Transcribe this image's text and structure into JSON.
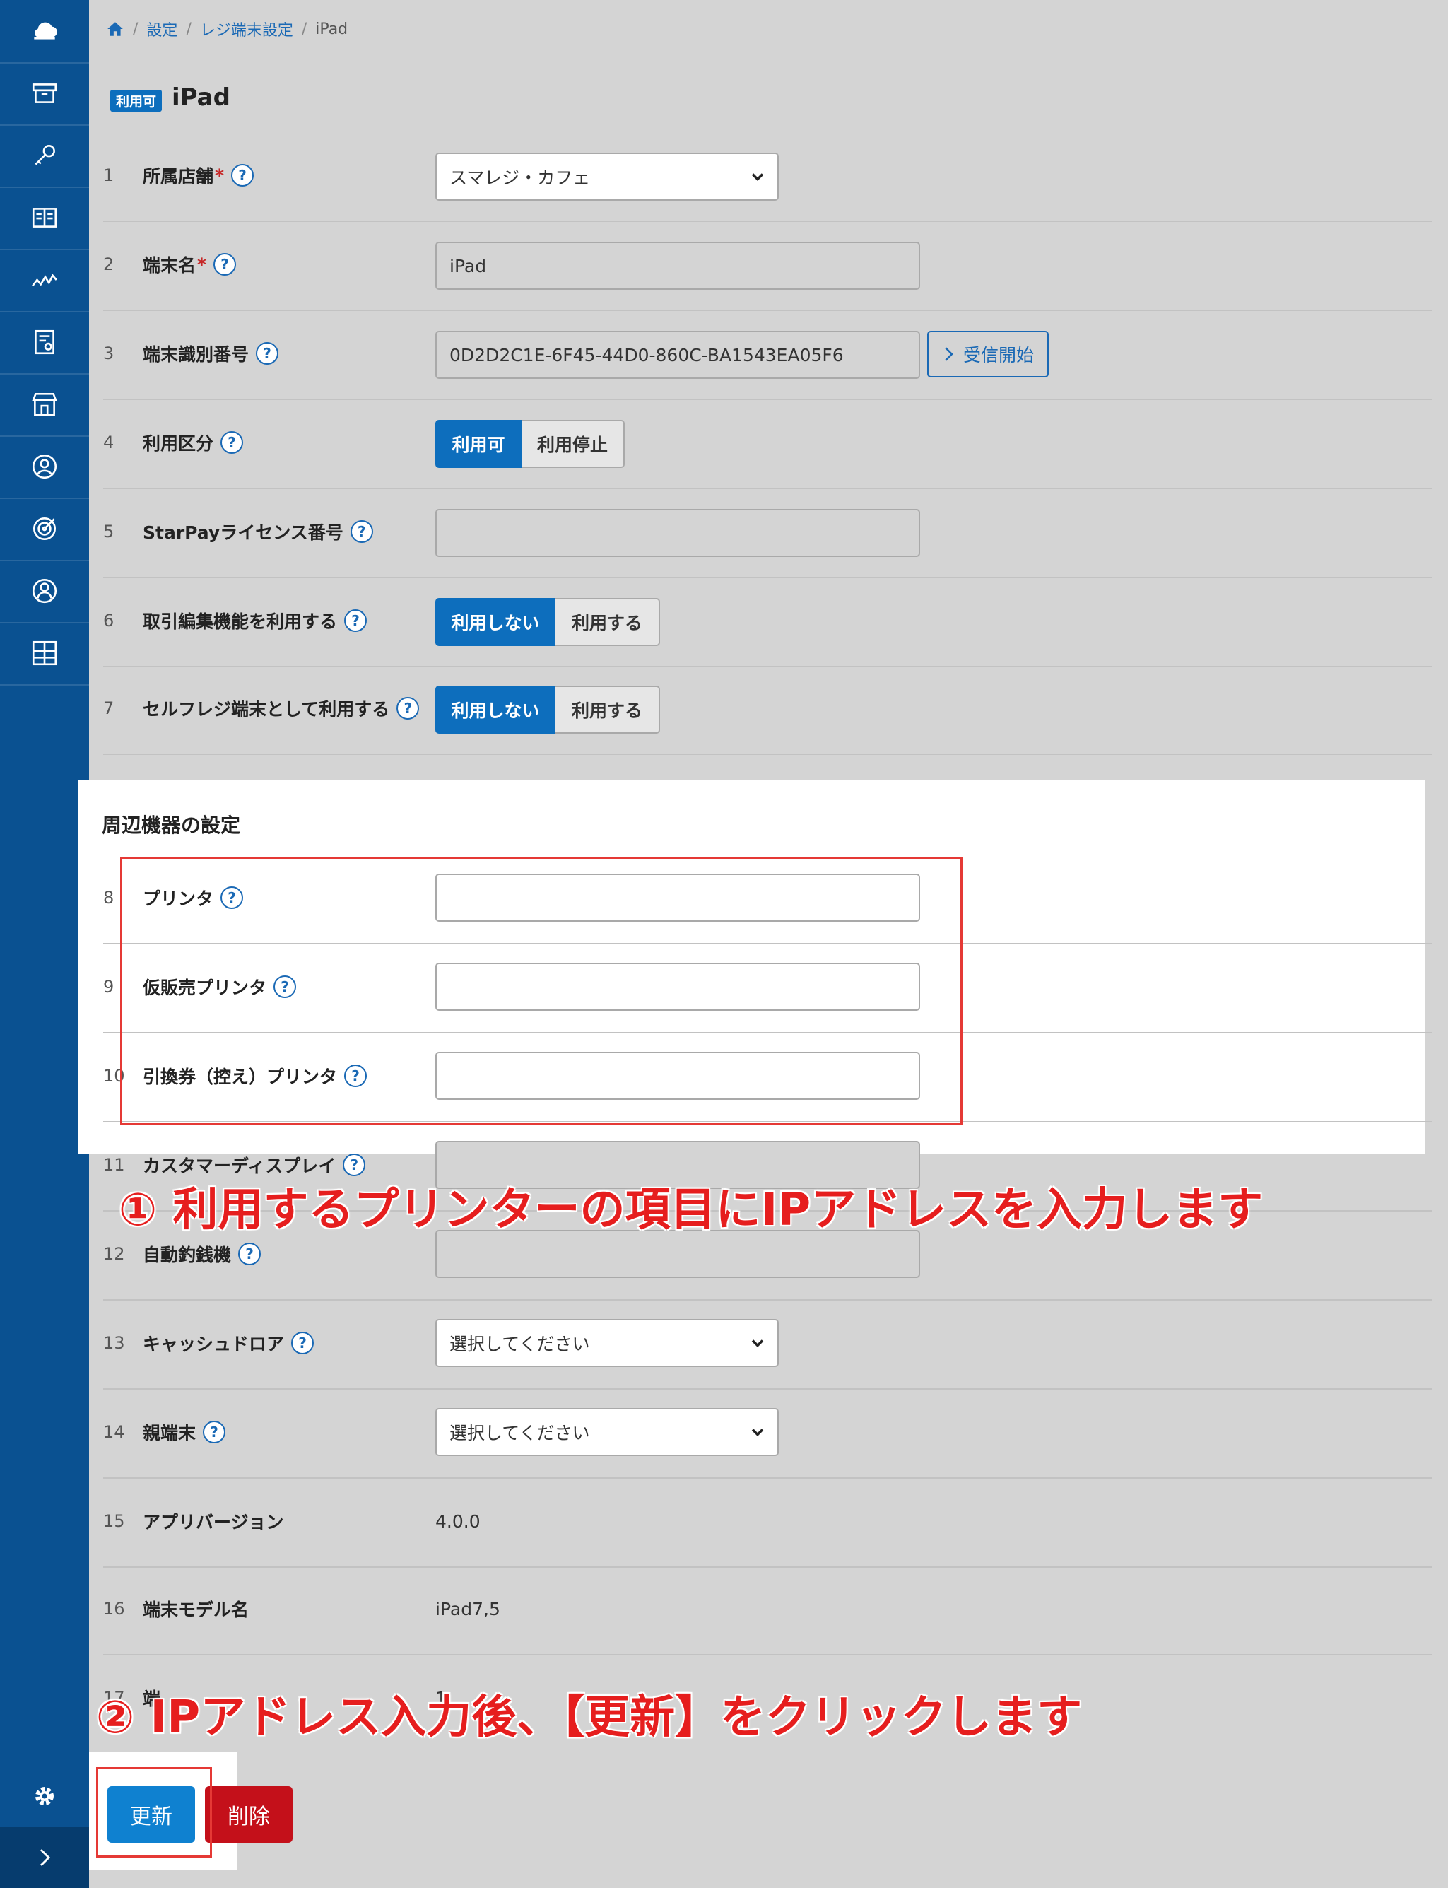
{
  "breadcrumb": {
    "settings": "設定",
    "register_settings": "レジ端末設定",
    "current": "iPad"
  },
  "header": {
    "badge": "利用可",
    "title": "iPad"
  },
  "rows": [
    {
      "num": "1",
      "label": "所属店舗",
      "required": "*",
      "value": "スマレジ・カフェ"
    },
    {
      "num": "2",
      "label": "端末名",
      "required": "*",
      "value": "iPad"
    },
    {
      "num": "3",
      "label": "端末識別番号",
      "value": "0D2D2C1E-6F45-44D0-860C-BA1543EA05F6",
      "button": "受信開始"
    },
    {
      "num": "4",
      "label": "利用区分",
      "options": [
        "利用可",
        "利用停止"
      ],
      "selected": "利用可"
    },
    {
      "num": "5",
      "label": "StarPayライセンス番号",
      "value": ""
    },
    {
      "num": "6",
      "label": "取引編集機能を利用する",
      "options": [
        "利用しない",
        "利用する"
      ],
      "selected": "利用しない"
    },
    {
      "num": "7",
      "label": "セルフレジ端末として利用する",
      "options": [
        "利用しない",
        "利用する"
      ],
      "selected": "利用しない"
    }
  ],
  "peripherals": {
    "title": "周辺機器の設定",
    "rows": [
      {
        "num": "8",
        "label": "プリンタ",
        "value": ""
      },
      {
        "num": "9",
        "label": "仮販売プリンタ",
        "value": ""
      },
      {
        "num": "10",
        "label": "引換券（控え）プリンタ",
        "value": ""
      },
      {
        "num": "11",
        "label": "カスタマーディスプレイ",
        "value": ""
      },
      {
        "num": "12",
        "label": "自動釣銭機",
        "value": ""
      },
      {
        "num": "13",
        "label": "キャッシュドロア",
        "value": "選択してください"
      },
      {
        "num": "14",
        "label": "親端末",
        "value": "選択してください"
      },
      {
        "num": "15",
        "label": "アプリバージョン",
        "value": "4.0.0"
      },
      {
        "num": "16",
        "label": "端末モデル名",
        "value": "iPad7,5"
      },
      {
        "num": "17",
        "label": "端",
        "value": "1"
      }
    ]
  },
  "annotations": {
    "step1": "① 利用するプリンターの項目にIPアドレスを入力します",
    "step2": "② IPアドレス入力後、【更新】をクリックします"
  },
  "actions": {
    "update": "更新",
    "delete": "削除"
  },
  "help_mark": "?",
  "colors": {
    "sidebar": "#0a5191",
    "primary": "#0d6ebd",
    "danger": "#c4101a",
    "annotation": "#e61e1e"
  }
}
